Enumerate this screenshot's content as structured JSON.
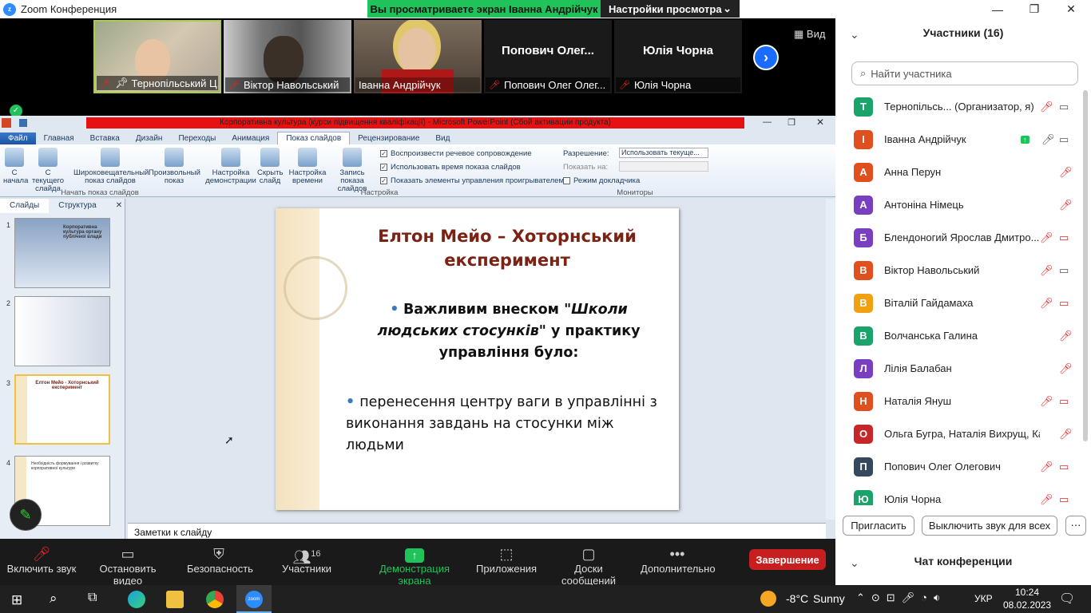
{
  "window": {
    "title": "Zoom Конференция",
    "banner_view": "Вы просматриваете экран Іванна Андрійчук",
    "banner_settings": "Настройки просмотра"
  },
  "video_tiles": [
    {
      "name": "Тернопільський Ц..."
    },
    {
      "name": "Віктор Навольський"
    },
    {
      "name": "Іванна Андрійчук"
    },
    {
      "name": "Попович Олег Олег...",
      "big": "Попович  Олег..."
    },
    {
      "name": "Юлія Чорна",
      "big": "Юлія Чорна"
    }
  ],
  "view_label": "Вид",
  "ppt": {
    "title": "Корпоративна культура (курси підвищення кваліфікації)  -  Microsoft PowerPoint (Сбой активации продукта)",
    "tabs": [
      "Файл",
      "Главная",
      "Вставка",
      "Дизайн",
      "Переходы",
      "Анимация",
      "Показ слайдов",
      "Рецензирование",
      "Вид"
    ],
    "ribbon": {
      "b1": "С начала",
      "b2": "С текущего слайда",
      "b3": "Широковещательный показ слайдов",
      "b4": "Произвольный показ",
      "g1": "Начать показ слайдов",
      "b5": "Настройка демонстрации",
      "b6": "Скрыть слайд",
      "b7": "Настройка времени",
      "b8": "Запись показа слайдов",
      "c1": "Воспроизвести речевое сопровождение",
      "c2": "Использовать время показа слайдов",
      "c3": "Показать элементы управления проигрывателем",
      "g2": "Настройка",
      "res_label": "Разрешение:",
      "res_value": "Использовать текуще...",
      "show_on": "Показать на:",
      "presenter": "Режим докладчика",
      "g3": "Мониторы"
    },
    "left_tabs": [
      "Слайды",
      "Структура"
    ],
    "thumbs": [
      {
        "num": "1",
        "text": "Корпоративна культура органу публічної влади"
      },
      {
        "num": "2",
        "text": ""
      },
      {
        "num": "3",
        "text": "Елтон Мейо - Хоторнський експеримент"
      },
      {
        "num": "4",
        "text": "Необхідність формування і розвитку корпоративної культури"
      }
    ],
    "slide": {
      "title": "Елтон Мейо – Хоторнський експеримент",
      "b1_bold": "Важливим внеском ",
      "b1_italic": "\"Школи людських стосунків\"",
      "b1_rest": " у практику управління було:",
      "b2": "перенесення  центру ваги в управлінні з виконання  завдань на стосунки між людьми"
    },
    "notes": "Заметки к слайду"
  },
  "panel": {
    "title": "Участники (16)",
    "search_placeholder": "Найти участника",
    "participants": [
      {
        "initial": "Т",
        "name": "Тернопільсь...  (Организатор, я)",
        "color": "#1aa36a"
      },
      {
        "initial": "І",
        "name": "Іванна Андрійчук",
        "color": "#e0501e"
      },
      {
        "initial": "А",
        "name": "Анна Перун",
        "color": "#e0501e"
      },
      {
        "initial": "А",
        "name": "Антоніна Німець",
        "color": "#7a3fc0"
      },
      {
        "initial": "Б",
        "name": "Блендоногий Ярослав Дмитро...",
        "color": "#7a3fc0"
      },
      {
        "initial": "В",
        "name": "Віктор Навольський",
        "color": "#e0501e"
      },
      {
        "initial": "В",
        "name": "Віталій Гайдамаха",
        "color": "#f0a010"
      },
      {
        "initial": "В",
        "name": "Волчанська Галина",
        "color": "#1aa36a"
      },
      {
        "initial": "Л",
        "name": "Лілія Балабан",
        "color": "#7a3fc0"
      },
      {
        "initial": "Н",
        "name": "Наталія Януш",
        "color": "#e0501e"
      },
      {
        "initial": "О",
        "name": "Ольга Бугра, Наталія Вихрущ, Кат...",
        "color": "#c62828"
      },
      {
        "initial": "П",
        "name": "Попович Олег Олегович",
        "color": "#34495e"
      },
      {
        "initial": "Ю",
        "name": "Юлія Чорна",
        "color": "#1aa36a"
      }
    ],
    "invite": "Пригласить",
    "mute_all": "Выключить звук для всех",
    "chat": "Чат конференции"
  },
  "toolbar": {
    "unmute": "Включить звук",
    "video": "Остановить видео",
    "security": "Безопасность",
    "participants": "Участники",
    "participants_count": "16",
    "share": "Демонстрация экрана",
    "apps": "Приложения",
    "boards": "Доски сообщений",
    "more": "Дополнительно",
    "end": "Завершение"
  },
  "taskbar": {
    "weather_temp": "-8°C",
    "weather_text": "Sunny",
    "lang": "УКР",
    "time": "10:24",
    "date": "08.02.2023"
  }
}
